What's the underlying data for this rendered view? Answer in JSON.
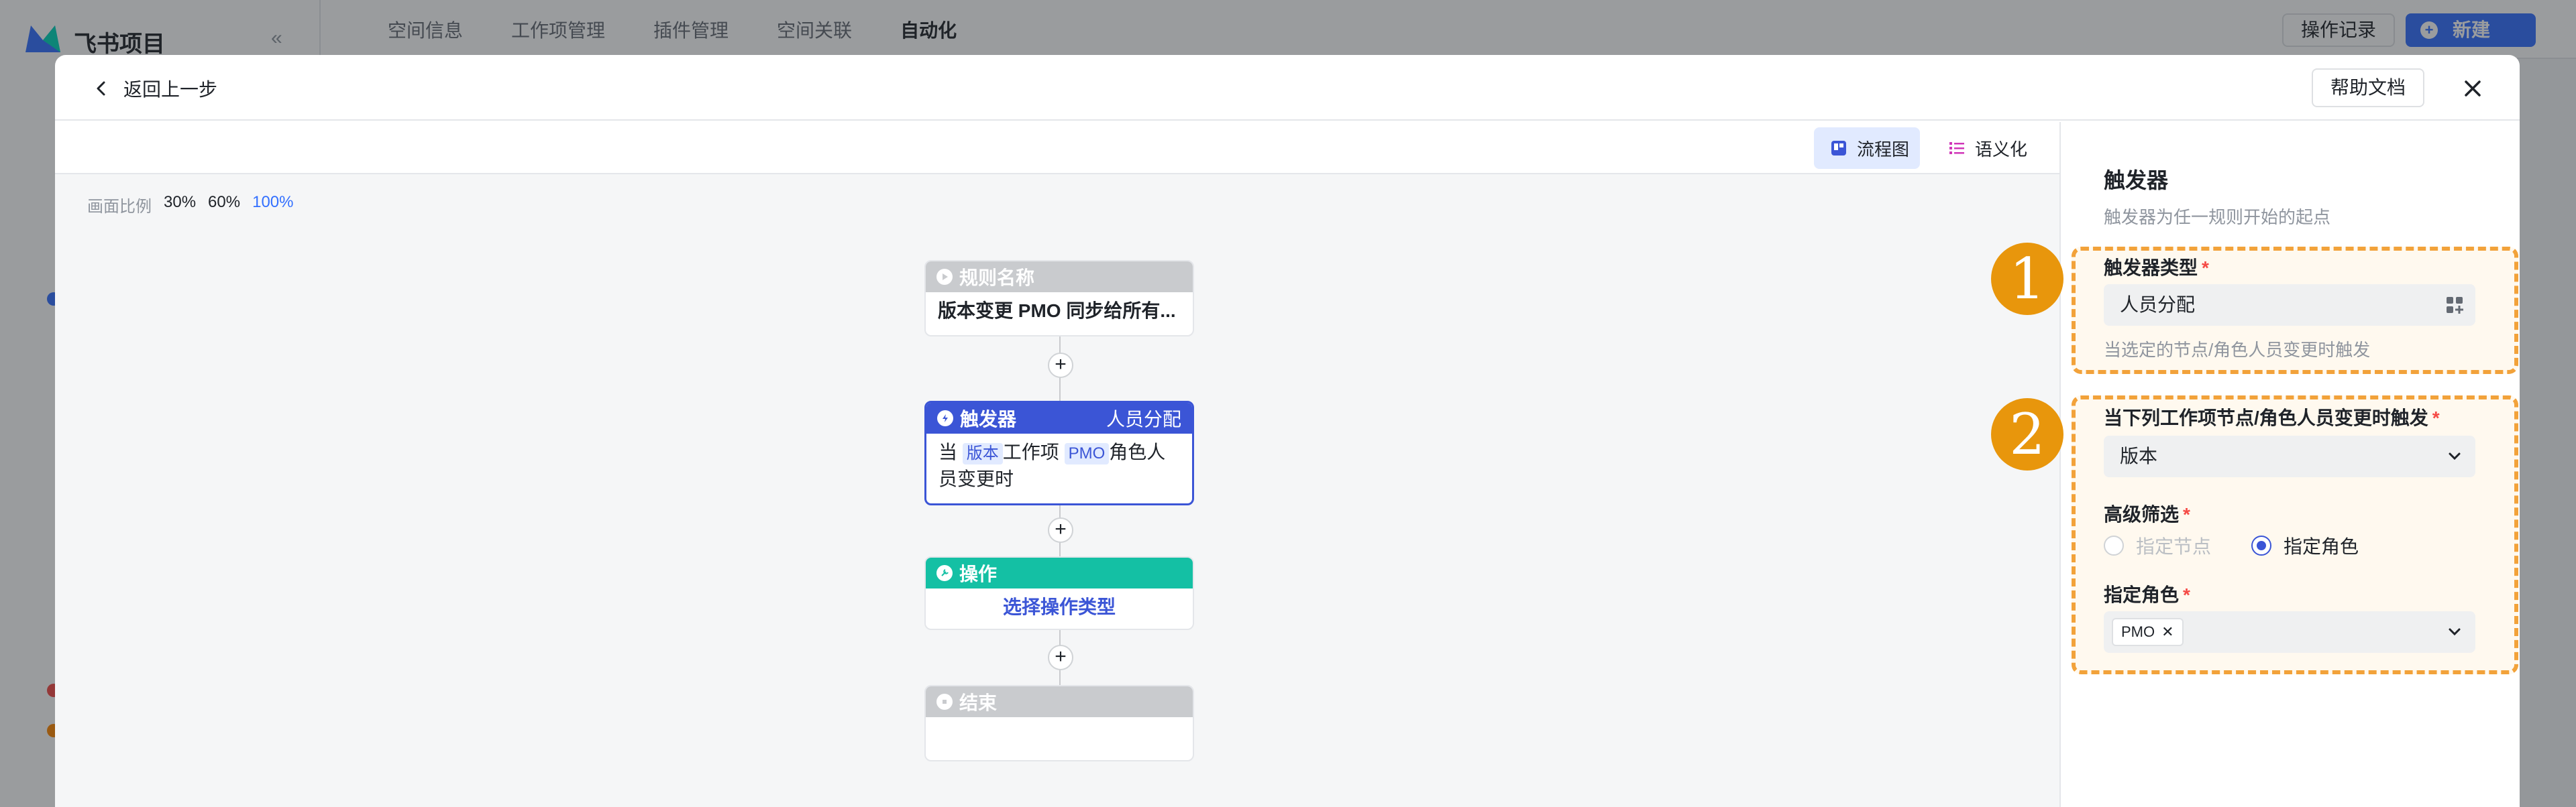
{
  "background": {
    "app_title": "飞书项目",
    "collapse_icon": "«",
    "tabs": [
      "空间信息",
      "工作项管理",
      "插件管理",
      "空间关联",
      "自动化"
    ],
    "active_tab": "自动化",
    "op_log_label": "操作记录",
    "new_label": "新建"
  },
  "modal": {
    "back_label": "返回上一步",
    "help_label": "帮助文档",
    "view_flow_label": "流程图",
    "view_semantic_label": "语义化"
  },
  "canvas": {
    "zoom_label": "画面比例",
    "zoom_options": [
      "30%",
      "60%",
      "100%"
    ],
    "zoom_selected": "100%",
    "nodes": {
      "rule": {
        "header": "规则名称",
        "body": "版本变更 PMO 同步给所有..."
      },
      "trigger": {
        "header": "触发器",
        "header_right": "人员分配",
        "text_prefix": "当",
        "tag1": "版本",
        "text_mid": "工作项",
        "tag2": "PMO",
        "text_suffix": "角色人员变更时"
      },
      "action": {
        "header": "操作",
        "body": "选择操作类型"
      },
      "end": {
        "header": "结束",
        "body": ""
      }
    },
    "plus_label": "+"
  },
  "panel": {
    "title": "触发器",
    "subtitle": "触发器为任一规则开始的起点",
    "trigger_type": {
      "label": "触发器类型",
      "value": "人员分配",
      "hint": "当选定的节点/角色人员变更时触发"
    },
    "node_role": {
      "label": "当下列工作项节点/角色人员变更时触发",
      "value": "版本"
    },
    "advanced": {
      "label": "高级筛选",
      "options": [
        "指定节点",
        "指定角色"
      ],
      "selected": "指定角色"
    },
    "role": {
      "label": "指定角色",
      "chip": "PMO"
    },
    "badges": [
      "1",
      "2"
    ],
    "required_mark": "*"
  },
  "colors": {
    "accent": "#3b55d6",
    "teal": "#14c0a4",
    "highlight": "#f2a23a",
    "badge": "#e8960c"
  }
}
